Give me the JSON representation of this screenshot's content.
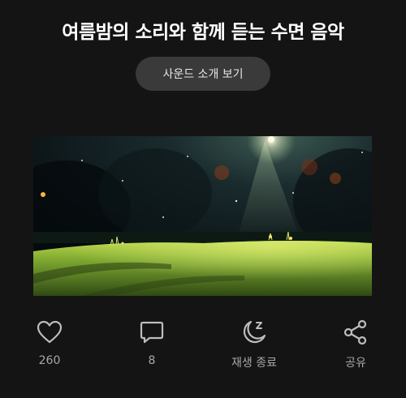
{
  "header": {
    "title": "여름밤의 소리와 함께 듣는 수면 음악"
  },
  "intro_button": {
    "label": "사운드 소개 보기"
  },
  "artwork": {
    "icon": "summer-night-meadow-image"
  },
  "actions": {
    "like": {
      "icon": "heart-icon",
      "count": "260"
    },
    "comment": {
      "icon": "speech-bubble-icon",
      "count": "8"
    },
    "sleep_timer": {
      "icon": "moon-zzz-icon",
      "label": "재생 종료"
    },
    "share": {
      "icon": "share-icon",
      "label": "공유"
    }
  },
  "colors": {
    "background": "#141414",
    "button_bg": "#3a3a3a",
    "icon_color": "#bdbdbd",
    "label_color": "#a8a8a8"
  }
}
